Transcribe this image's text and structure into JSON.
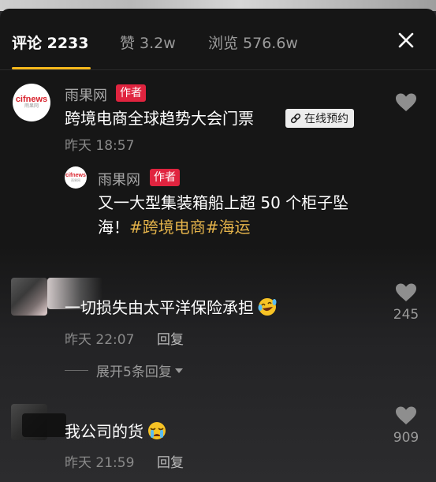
{
  "tabs": [
    {
      "label": "评论 2233",
      "active": true
    },
    {
      "label": "赞 3.2w",
      "active": false
    },
    {
      "label": "浏览 576.6w",
      "active": false
    }
  ],
  "icons": {
    "close": "close-icon",
    "heart": "heart-icon",
    "link": "link-icon",
    "caret": "caret-down-icon"
  },
  "colors": {
    "accent_tab": "#f5b81c",
    "author_badge": "#e0243f",
    "hashtag": "#e3b24a"
  },
  "comments": [
    {
      "avatar_text": "cifnews",
      "avatar_sub": "雨果网",
      "author": "雨果网",
      "badge": "作者",
      "text": "跨境电商全球趋势大会门票",
      "link_chip": "在线预约",
      "time": "昨天 18:57",
      "reply": {
        "avatar_text": "cifnews",
        "avatar_sub": "雨果网",
        "author": "雨果网",
        "badge": "作者",
        "text_plain_1": "又一大型集装箱船上超 50 个柜子坠",
        "text_plain_2": "海！",
        "hashtags": [
          "#跨境电商",
          "#海运"
        ]
      }
    },
    {
      "text": "一切损失由太平洋保险承担",
      "emoji": "laughing-tears-emoji",
      "time": "昨天 22:07",
      "reply_label": "回复",
      "likes": "245",
      "expand_label": "展开5条回复"
    },
    {
      "text": "我公司的货",
      "emoji": "crying-emoji",
      "time": "昨天 21:59",
      "reply_label": "回复",
      "likes": "909"
    }
  ]
}
